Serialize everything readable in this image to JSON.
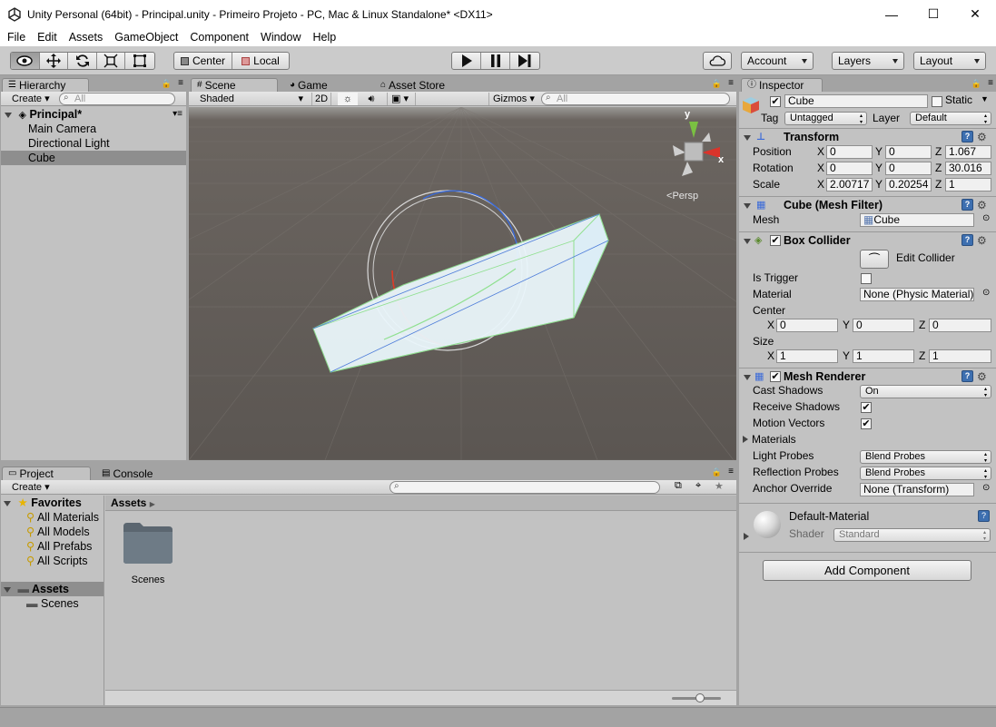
{
  "window": {
    "title": "Unity Personal (64bit) - Principal.unity - Primeiro Projeto - PC, Mac & Linux Standalone* <DX11>",
    "minimize": "—",
    "maximize": "☐",
    "close": "✕"
  },
  "menu": [
    "File",
    "Edit",
    "Assets",
    "GameObject",
    "Component",
    "Window",
    "Help"
  ],
  "toolbar": {
    "pivot": "Center",
    "space": "Local",
    "account": "Account",
    "layers": "Layers",
    "layout": "Layout"
  },
  "hierarchy": {
    "tab": "Hierarchy",
    "create": "Create",
    "search_placeholder": "All",
    "scene": "Principal*",
    "items": [
      "Main Camera",
      "Directional Light",
      "Cube"
    ]
  },
  "scene": {
    "tabs": [
      "Scene",
      "Game",
      "Asset Store"
    ],
    "shading": "Shaded",
    "mode2d": "2D",
    "gizmos": "Gizmos",
    "search_placeholder": "All",
    "persp": "Persp",
    "axis_y": "y",
    "axis_x": "x"
  },
  "project": {
    "tabs": [
      "Project",
      "Console"
    ],
    "create": "Create",
    "favorites_label": "Favorites",
    "favorites": [
      "All Materials",
      "All Models",
      "All Prefabs",
      "All Scripts"
    ],
    "assets_label": "Assets",
    "assets_children": [
      "Scenes"
    ],
    "breadcrumb": "Assets",
    "folder": "Scenes"
  },
  "inspector": {
    "tab": "Inspector",
    "name": "Cube",
    "static": "Static",
    "tag_label": "Tag",
    "tag": "Untagged",
    "layer_label": "Layer",
    "layer": "Default",
    "transform": {
      "title": "Transform",
      "position_label": "Position",
      "rotation_label": "Rotation",
      "scale_label": "Scale",
      "position": {
        "x": "0",
        "y": "0",
        "z": "1.067"
      },
      "rotation": {
        "x": "0",
        "y": "0",
        "z": "30.016"
      },
      "scale": {
        "x": "2.00717",
        "y": "0.20254",
        "z": "1"
      }
    },
    "mesh_filter": {
      "title": "Cube (Mesh Filter)",
      "mesh_label": "Mesh",
      "mesh": "Cube"
    },
    "box_collider": {
      "title": "Box Collider",
      "edit": "Edit Collider",
      "is_trigger": "Is Trigger",
      "material_label": "Material",
      "material": "None (Physic Material)",
      "center_label": "Center",
      "center": {
        "x": "0",
        "y": "0",
        "z": "0"
      },
      "size_label": "Size",
      "size": {
        "x": "1",
        "y": "1",
        "z": "1"
      }
    },
    "mesh_renderer": {
      "title": "Mesh Renderer",
      "cast_shadows_label": "Cast Shadows",
      "cast_shadows": "On",
      "receive_shadows": "Receive Shadows",
      "motion_vectors": "Motion Vectors",
      "materials": "Materials",
      "light_probes_label": "Light Probes",
      "light_probes": "Blend Probes",
      "reflection_probes_label": "Reflection Probes",
      "reflection_probes": "Blend Probes",
      "anchor_label": "Anchor Override",
      "anchor": "None (Transform)"
    },
    "material": {
      "name": "Default-Material",
      "shader_label": "Shader",
      "shader": "Standard"
    },
    "add_component": "Add Component"
  }
}
